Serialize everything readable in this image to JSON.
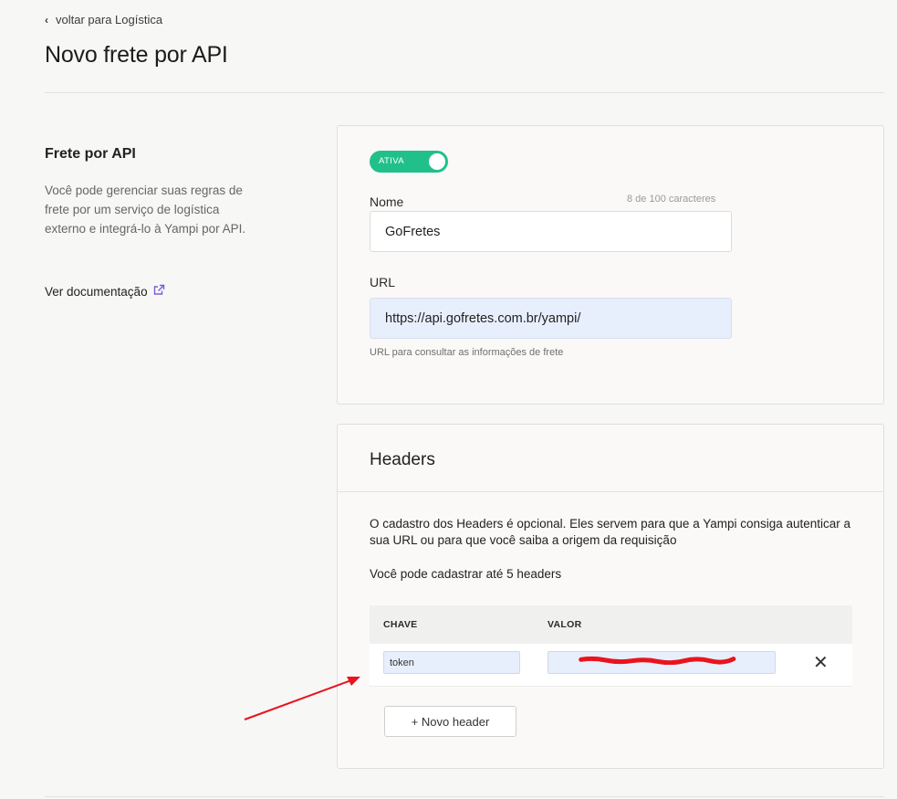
{
  "nav": {
    "back_label": "voltar para Logística"
  },
  "page": {
    "title": "Novo frete por API"
  },
  "sidebar": {
    "title": "Frete por API",
    "description": "Você pode gerenciar suas regras de frete por um serviço de logística externo e integrá-lo à Yampi por API.",
    "doc_link": "Ver documentação"
  },
  "general": {
    "toggle_label": "ATIVA",
    "toggle_on": true,
    "name_label": "Nome",
    "name_counter": "8 de 100 caracteres",
    "name_value": "GoFretes",
    "url_label": "URL",
    "url_value": "https://api.gofretes.com.br/yampi/",
    "url_help": "URL para consultar as informações de frete"
  },
  "headers": {
    "title": "Headers",
    "description": "O cadastro dos Headers é opcional. Eles servem para que a Yampi consiga autenticar a sua URL ou para que você saiba a origem da requisição",
    "limit_note": "Você pode cadastrar até 5 headers",
    "columns": {
      "key": "CHAVE",
      "value": "VALOR"
    },
    "rows": [
      {
        "key": "token",
        "value": ""
      }
    ],
    "add_button": "+ Novo header"
  },
  "colors": {
    "accent_green": "#21c08b",
    "link_purple": "#7c5cd6",
    "annotation_red": "#e8141e"
  }
}
